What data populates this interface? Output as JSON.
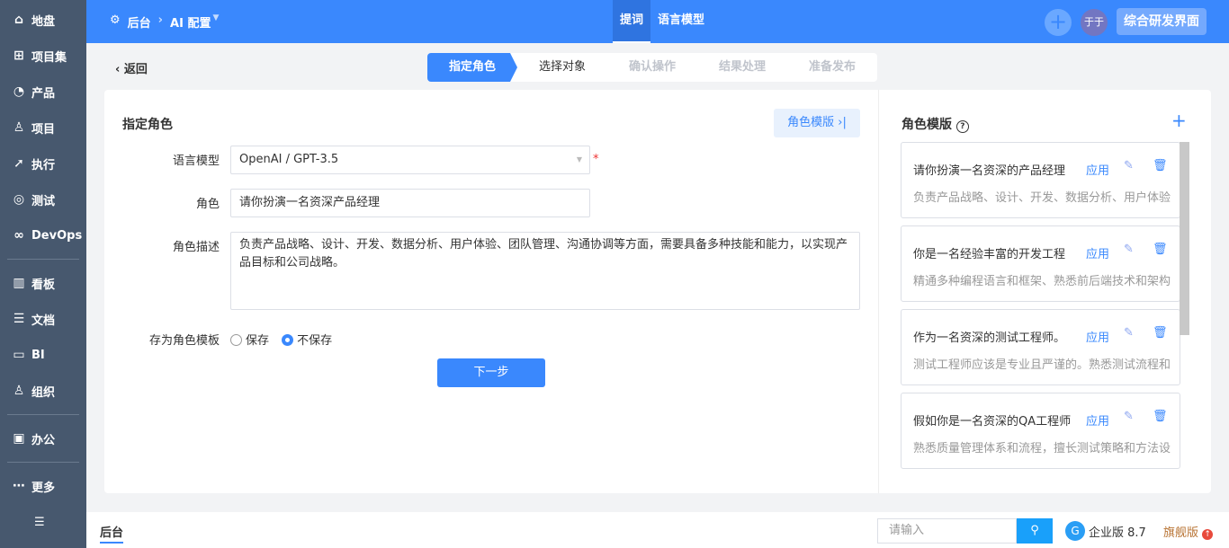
{
  "sidebar": {
    "items": [
      {
        "label": "地盘",
        "icon": "home-icon"
      },
      {
        "label": "项目集",
        "icon": "grid-icon"
      },
      {
        "label": "产品",
        "icon": "lightbulb-icon"
      },
      {
        "label": "项目",
        "icon": "project-icon"
      },
      {
        "label": "执行",
        "icon": "run-icon"
      },
      {
        "label": "测试",
        "icon": "test-icon"
      },
      {
        "label": "DevOps",
        "icon": "infinity-icon"
      },
      {
        "label": "看板",
        "icon": "kanban-icon"
      },
      {
        "label": "文档",
        "icon": "doc-icon"
      },
      {
        "label": "BI",
        "icon": "chart-icon"
      },
      {
        "label": "组织",
        "icon": "user-icon"
      },
      {
        "label": "办公",
        "icon": "office-icon"
      },
      {
        "label": "更多",
        "icon": "more-icon"
      }
    ]
  },
  "header": {
    "crumb_home": "后台",
    "crumb_current": "AI 配置",
    "tabs": [
      "提词",
      "语言模型"
    ],
    "avatar": "于于",
    "switch_label": "综合研发界面"
  },
  "back_label": "返回",
  "steps": [
    "指定角色",
    "选择对象",
    "确认操作",
    "结果处理",
    "准备发布"
  ],
  "form": {
    "title": "指定角色",
    "template_button": "角色模版",
    "model_label": "语言模型",
    "model_value": "OpenAI / GPT-3.5",
    "role_label": "角色",
    "role_value": "请你扮演一名资深产品经理",
    "desc_label": "角色描述",
    "desc_value": "负责产品战略、设计、开发、数据分析、用户体验、团队管理、沟通协调等方面，需要具备多种技能和能力，以实现产品目标和公司战略。",
    "save_label": "存为角色模板",
    "save_option": "保存",
    "nosave_option": "不保存",
    "selected": "不保存",
    "next_button": "下一步"
  },
  "templates": {
    "title": "角色模版",
    "apply": "应用",
    "items": [
      {
        "title": "请你扮演一名资深的产品经理",
        "desc": "负责产品战略、设计、开发、数据分析、用户体验"
      },
      {
        "title": "你是一名经验丰富的开发工程",
        "desc": "精通多种编程语言和框架、熟悉前后端技术和架构"
      },
      {
        "title": "作为一名资深的测试工程师。",
        "desc": "测试工程师应该是专业且严谨的。熟悉测试流程和"
      },
      {
        "title": "假如你是一名资深的QA工程师",
        "desc": "熟悉质量管理体系和流程，擅长测试策略和方法设"
      }
    ]
  },
  "bottom": {
    "tab": "后台",
    "search_placeholder": "请输入",
    "edition": "企业版 8.7",
    "flagship": "旗舰版"
  },
  "colors": {
    "accent": "#3a88fd",
    "sidebar": "#47586e"
  }
}
